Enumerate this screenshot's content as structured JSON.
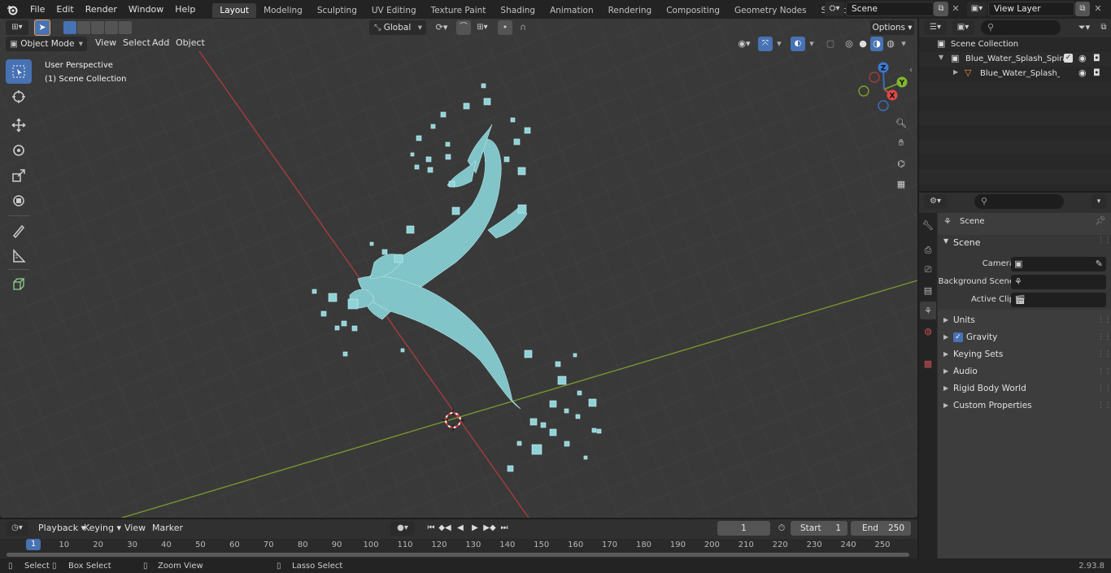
{
  "topbar": {
    "menus": [
      "File",
      "Edit",
      "Render",
      "Window",
      "Help"
    ],
    "workspaces": [
      "Layout",
      "Modeling",
      "Sculpting",
      "UV Editing",
      "Texture Paint",
      "Shading",
      "Animation",
      "Rendering",
      "Compositing",
      "Geometry Nodes",
      "Scripting"
    ],
    "active_workspace": "Layout",
    "scene_name": "Scene",
    "view_layer": "View Layer"
  },
  "viewport": {
    "mode": "Object Mode",
    "menus": [
      "View",
      "Select",
      "Add",
      "Object"
    ],
    "transform_orientation": "Global",
    "options_label": "Options",
    "overlay_title": "User Perspective",
    "overlay_subtitle": "(1) Scene Collection",
    "gizmo_axes": {
      "z": "Z",
      "y": "Y",
      "x": "X"
    }
  },
  "outliner": {
    "root": "Scene Collection",
    "items": [
      {
        "label": "Blue_Water_Splash_Spiral",
        "kind": "collection"
      },
      {
        "label": "Blue_Water_Splash_Spiral",
        "kind": "object"
      }
    ]
  },
  "properties": {
    "header": "Scene",
    "panel": "Scene",
    "fields": [
      {
        "label": "Camera",
        "value": ""
      },
      {
        "label": "Background Scene",
        "value": ""
      },
      {
        "label": "Active Clip",
        "value": ""
      }
    ],
    "sections": [
      "Units",
      "Gravity",
      "Keying Sets",
      "Audio",
      "Rigid Body World",
      "Custom Properties"
    ],
    "gravity_checked": true
  },
  "timeline": {
    "menus": [
      "Playback",
      "Keying",
      "View",
      "Marker"
    ],
    "current_frame": "1",
    "start_label": "Start",
    "start": "1",
    "end_label": "End",
    "end": "250",
    "ticks": [
      "1",
      "10",
      "20",
      "30",
      "40",
      "50",
      "60",
      "70",
      "80",
      "90",
      "100",
      "110",
      "120",
      "130",
      "140",
      "150",
      "160",
      "170",
      "180",
      "190",
      "200",
      "210",
      "220",
      "230",
      "240",
      "250"
    ]
  },
  "statusbar": {
    "select": "Select",
    "box_select": "Box Select",
    "zoom_view": "Zoom View",
    "lasso_select": "Lasso Select",
    "version": "2.93.8"
  },
  "colors": {
    "accent": "#4772b3",
    "x_axis": "#b03c3c",
    "y_axis": "#7c9a2e",
    "mesh": "#8ed3d8"
  }
}
